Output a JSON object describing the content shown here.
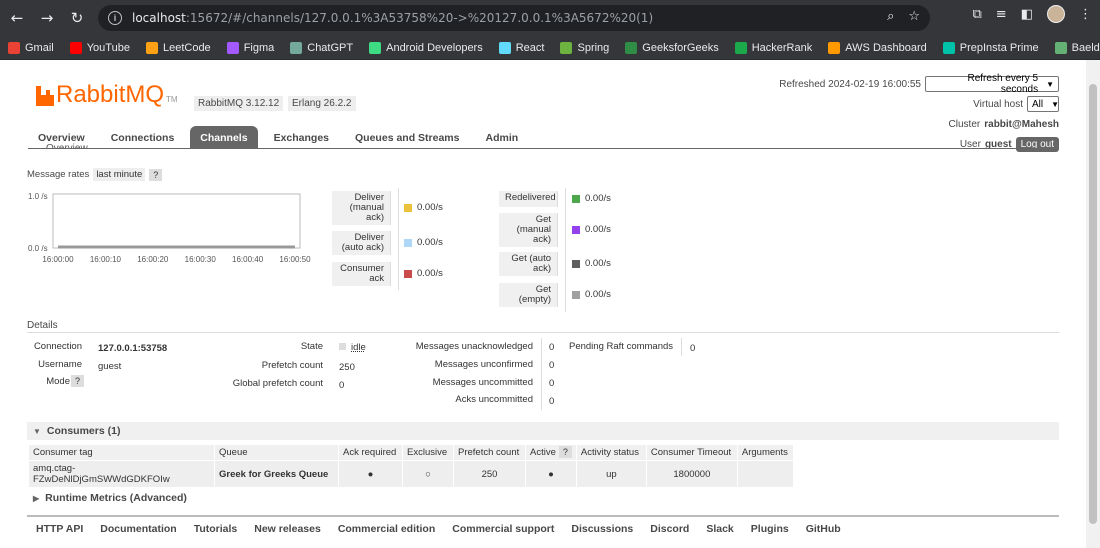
{
  "browser": {
    "url_host": "localhost",
    "url_rest": ":15672/#/channels/127.0.0.1%3A53758%20->%20127.0.0.1%3A5672%20(1)",
    "bookmarks": [
      {
        "label": "Gmail",
        "color": "#ea4335"
      },
      {
        "label": "YouTube",
        "color": "#ff0000"
      },
      {
        "label": "LeetCode",
        "color": "#ffa116"
      },
      {
        "label": "Figma",
        "color": "#a259ff"
      },
      {
        "label": "ChatGPT",
        "color": "#74aa9c"
      },
      {
        "label": "Android Developers",
        "color": "#3ddc84"
      },
      {
        "label": "React",
        "color": "#61dafb"
      },
      {
        "label": "Spring",
        "color": "#6db33f"
      },
      {
        "label": "GeeksforGeeks",
        "color": "#2f8d46"
      },
      {
        "label": "HackerRank",
        "color": "#1ba94c"
      },
      {
        "label": "AWS Dashboard",
        "color": "#ff9900"
      },
      {
        "label": "PrepInsta Prime",
        "color": "#00c2a8"
      },
      {
        "label": "Baeldung",
        "color": "#63b175"
      }
    ]
  },
  "header": {
    "logo_text": "RabbitMQ",
    "logo_tm": "TM",
    "rabbitmq_version": "RabbitMQ 3.12.12",
    "erlang_version": "Erlang 26.2.2",
    "refreshed_label": "Refreshed 2024-02-19 16:00:55",
    "refresh_option": "Refresh every 5 seconds",
    "vhost_label": "Virtual host",
    "vhost_value": "All",
    "cluster_label": "Cluster",
    "cluster_value": "rabbit@Mahesh",
    "user_label": "User",
    "user_value": "guest",
    "logout_label": "Log out"
  },
  "tabs": [
    {
      "label": "Overview",
      "active": false
    },
    {
      "label": "Connections",
      "active": false
    },
    {
      "label": "Channels",
      "active": true
    },
    {
      "label": "Exchanges",
      "active": false
    },
    {
      "label": "Queues and Streams",
      "active": false
    },
    {
      "label": "Admin",
      "active": false
    }
  ],
  "cut_heading": "Overview",
  "message_rates": {
    "label": "Message rates",
    "range": "last minute",
    "help": "?",
    "left": [
      {
        "label_lines": [
          "Deliver",
          "(manual",
          "ack)"
        ],
        "value": "0.00/s",
        "color": "#edc240"
      },
      {
        "label_lines": [
          "Deliver",
          "(auto ack)"
        ],
        "value": "0.00/s",
        "color": "#afd8f8"
      },
      {
        "label_lines": [
          "Consumer",
          "ack"
        ],
        "value": "0.00/s",
        "color": "#cb4b4b"
      }
    ],
    "right": [
      {
        "label_lines": [
          "Redelivered"
        ],
        "value": "0.00/s",
        "color": "#4da74d"
      },
      {
        "label_lines": [
          "Get",
          "(manual",
          "ack)"
        ],
        "value": "0.00/s",
        "color": "#9440ed"
      },
      {
        "label_lines": [
          "Get (auto",
          "ack)"
        ],
        "value": "0.00/s",
        "color": "#5e5e5e"
      },
      {
        "label_lines": [
          "Get",
          "(empty)"
        ],
        "value": "0.00/s",
        "color": "#a0a0a0"
      }
    ]
  },
  "chart_data": {
    "type": "line",
    "x": [
      "16:00:00",
      "16:00:10",
      "16:00:20",
      "16:00:30",
      "16:00:40",
      "16:00:50"
    ],
    "y_ticks": [
      "1.0 /s",
      "0.0 /s"
    ],
    "ylim": [
      0,
      1
    ],
    "series": [
      {
        "values": [
          0,
          0,
          0,
          0,
          0,
          0
        ]
      }
    ],
    "grid": false
  },
  "details": {
    "label": "Details",
    "connection_label": "Connection",
    "connection_value": "127.0.0.1:53758",
    "username_label": "Username",
    "username_value": "guest",
    "mode_label": "Mode",
    "mode_help": "?",
    "state_label": "State",
    "state_value": "idle",
    "prefetch_label": "Prefetch count",
    "prefetch_value": "250",
    "global_prefetch_label": "Global prefetch count",
    "global_prefetch_value": "0",
    "unacked_label": "Messages unacknowledged",
    "unacked_value": "0",
    "unconfirmed_label": "Messages unconfirmed",
    "unconfirmed_value": "0",
    "uncommitted_label": "Messages uncommitted",
    "uncommitted_value": "0",
    "acks_uncommitted_label": "Acks uncommitted",
    "acks_uncommitted_value": "0",
    "pending_raft_label": "Pending Raft commands",
    "pending_raft_value": "0"
  },
  "consumers": {
    "title": "Consumers (1)",
    "columns": [
      "Consumer tag",
      "Queue",
      "Ack required",
      "Exclusive",
      "Prefetch count",
      "Active",
      "Activity status",
      "Consumer Timeout",
      "Arguments"
    ],
    "active_help": "?",
    "row": {
      "tag": "amq.ctag-FZwDeNlDjGmSWWdGDKFOIw",
      "queue": "Greek for Greeks Queue",
      "ack_required": "●",
      "exclusive": "○",
      "prefetch": "250",
      "active": "●",
      "status": "up",
      "timeout": "1800000",
      "arguments": ""
    }
  },
  "runtime_metrics": "Runtime Metrics (Advanced)",
  "footer": [
    "HTTP API",
    "Documentation",
    "Tutorials",
    "New releases",
    "Commercial edition",
    "Commercial support",
    "Discussions",
    "Discord",
    "Slack",
    "Plugins",
    "GitHub"
  ]
}
